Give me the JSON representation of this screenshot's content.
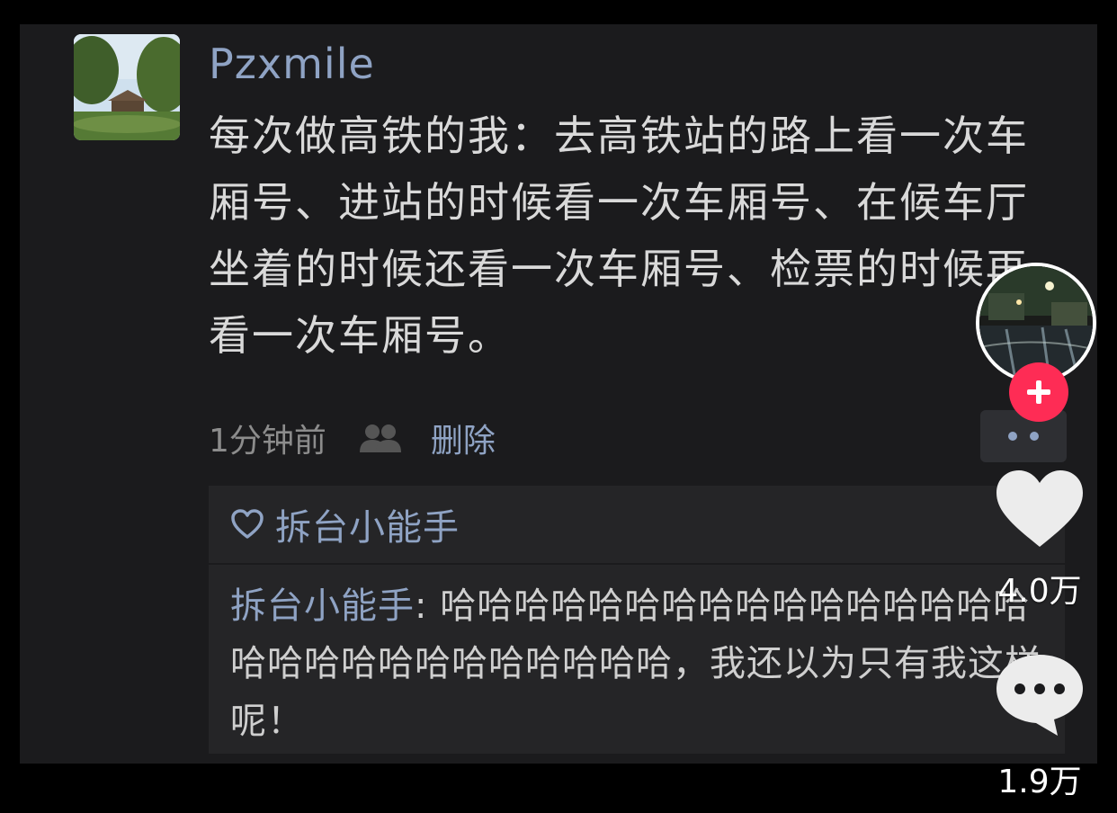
{
  "post": {
    "username": "Pzxmile",
    "text": "每次做高铁的我：去高铁站的路上看一次车厢号、进站的时候看一次车厢号、在候车厅坐着的时候还看一次车厢号、检票的时候再看一次车厢号。",
    "time": "1分钟前",
    "delete_label": "删除"
  },
  "replies": {
    "liker": "拆台小能手",
    "comment_author": "拆台小能手",
    "comment_text": ": 哈哈哈哈哈哈哈哈哈哈哈哈哈哈哈哈哈哈哈哈哈哈哈哈哈哈哈哈，我还以为只有我这样呢！"
  },
  "sidebar": {
    "like_count": "4.0万",
    "comment_count": "1.9万"
  },
  "icons": {
    "friends": "friends-icon",
    "more": "more-dots-icon",
    "like_small": "heart-outline-icon",
    "like": "heart-icon",
    "comment": "comment-bubble-icon",
    "follow": "plus-icon"
  },
  "colors": {
    "link": "#8fa3c4",
    "follow": "#fe2c55"
  }
}
